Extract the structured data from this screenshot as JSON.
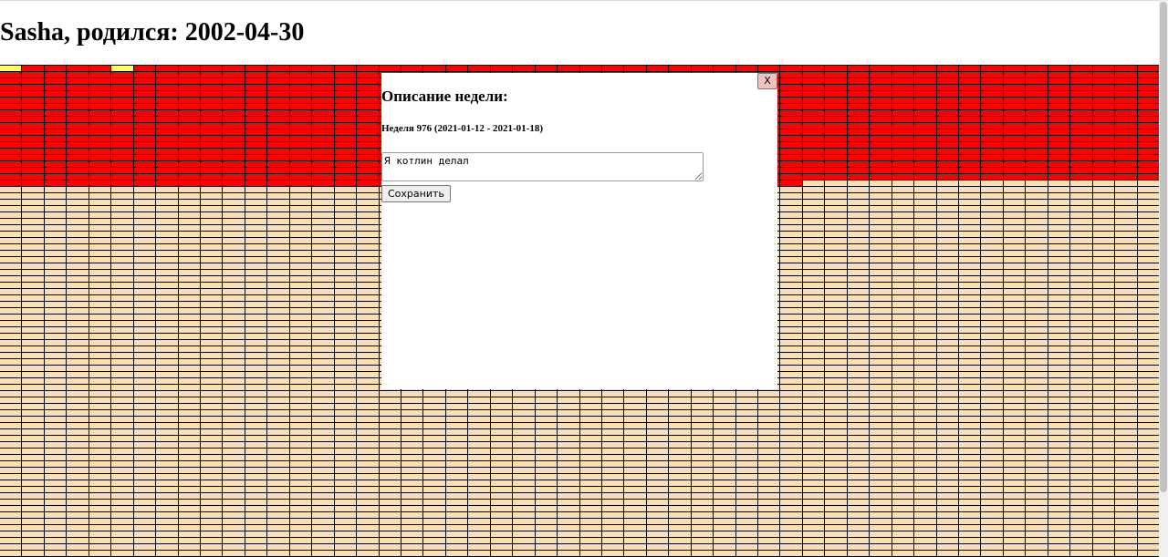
{
  "header": {
    "title": "Sasha, родился: 2002-04-30"
  },
  "calendar": {
    "columns": 52,
    "lived_full_rows": 16,
    "lived_weeks": 972,
    "noted_weeks": [
      0,
      5
    ],
    "colors": {
      "lived": "#ff0000",
      "future": "#f5dfb3",
      "noted": "#ffff66",
      "border": "#000000"
    }
  },
  "modal": {
    "close_label": "X",
    "heading": "Описание недели:",
    "week_label": "Неделя 976 (2021-01-12 - 2021-01-18)",
    "textarea_value": "Я котлин делал",
    "save_label": "Сохранить"
  }
}
